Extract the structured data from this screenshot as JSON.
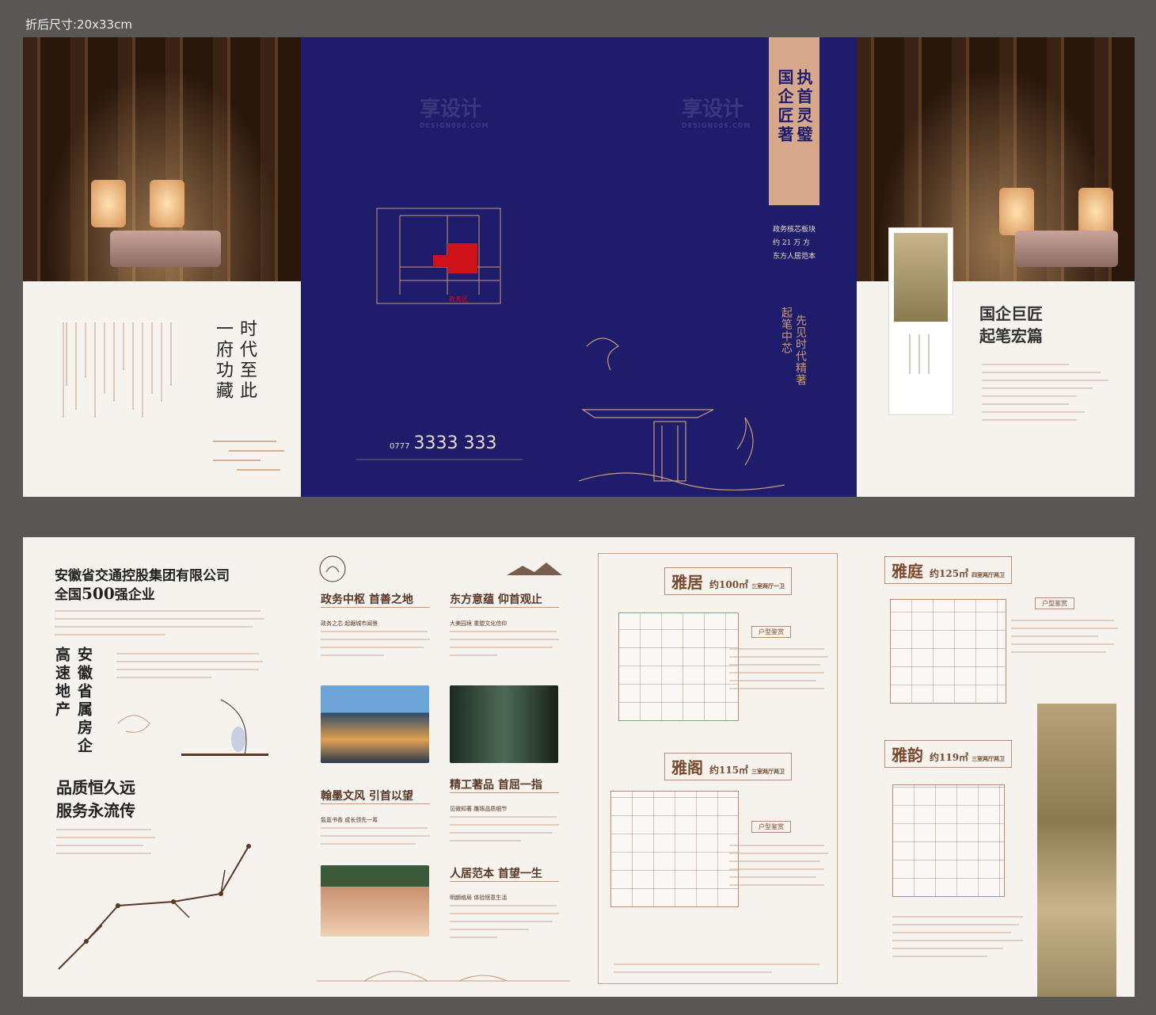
{
  "size_label": "折后尺寸:20x33cm",
  "cover": {
    "tagline": [
      "时代至此",
      "一府功藏"
    ],
    "hotline_prefix": "0777",
    "hotline": "3333  333",
    "right_title": [
      "执首灵璧",
      "国企匠著"
    ],
    "right_lines": [
      "政务核芯板块",
      "约 21 万 方",
      "东方人居范本"
    ],
    "vertical_small": [
      "先见时代精著",
      "起笔中芯"
    ],
    "map_label": "政务区",
    "fold_title": [
      "国企巨匠",
      "起笔宏篇"
    ]
  },
  "company": {
    "name": "安徽省交通控股集团有限公司",
    "rank_prefix": "全国",
    "rank_num": "500",
    "rank_suffix": "强企业",
    "vertical": [
      "安徽省属房企",
      "高速地产"
    ],
    "slogan": [
      "品质恒久远",
      "服务永流传"
    ]
  },
  "location": {
    "sections": [
      {
        "title": "政务中枢 首善之地",
        "sub": "政务之芯 起踞城市闻景"
      },
      {
        "title": "东方意蕴 仰首观止",
        "sub": "大美园境 重塑文化信仰"
      },
      {
        "title": "翰墨文风 引首以望",
        "sub": "氤氲书香 成长领先一筹"
      },
      {
        "title": "精工著品 首屈一指",
        "sub": "见微知著 雕琢品质细节"
      },
      {
        "title": "人居范本 首望一生",
        "sub": "明朗格局 体验惬意生活"
      }
    ]
  },
  "units": [
    {
      "name": "雅居",
      "size": "约100㎡",
      "layout": "三室两厅一卫",
      "tag": "户型鉴赏"
    },
    {
      "name": "雅阁",
      "size": "约115㎡",
      "layout": "三室两厅两卫",
      "tag": "户型鉴赏"
    },
    {
      "name": "雅庭",
      "size": "约125㎡",
      "layout": "四室两厅两卫",
      "tag": "户型鉴赏"
    },
    {
      "name": "雅韵",
      "size": "约119㎡",
      "layout": "三室两厅两卫",
      "tag": "户型鉴赏"
    }
  ],
  "watermark": {
    "cn": "享设计",
    "en": "DESIGN006.COM"
  },
  "colors": {
    "navy": "#1f1c6b",
    "cream": "#f6f2ee",
    "gold": "#c9997a",
    "brown": "#7a4a2e",
    "red": "#d0121b"
  }
}
